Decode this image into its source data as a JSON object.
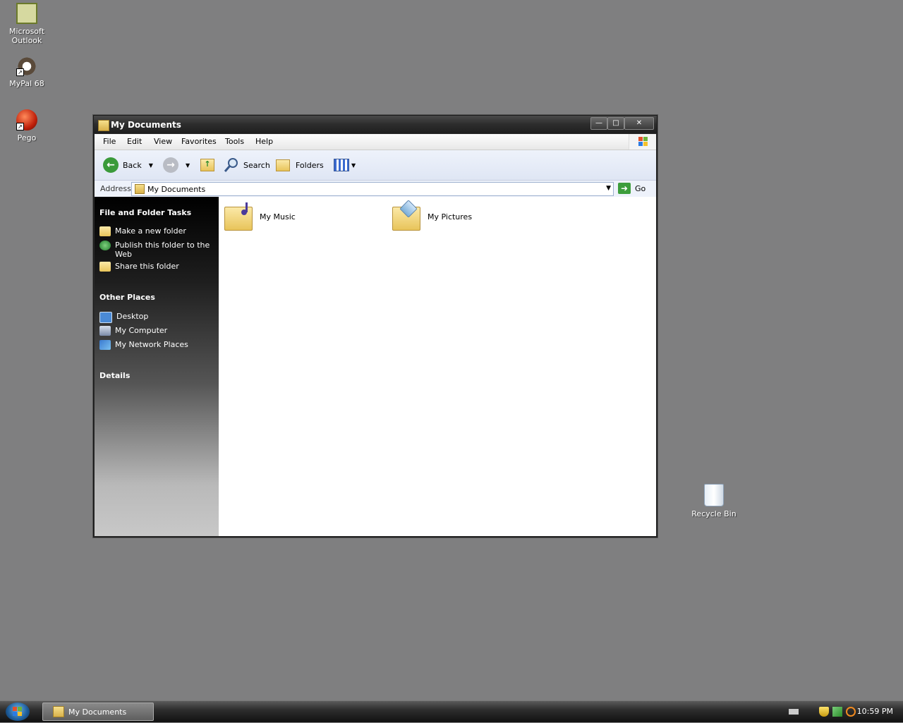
{
  "desktop": {
    "icons": [
      {
        "label_line1": "Microsoft",
        "label_line2": "Outlook",
        "icon": "outlook-icon"
      },
      {
        "label": "MyPal 68",
        "icon": "mypal-icon"
      },
      {
        "label": "Pego",
        "icon": "pego-icon"
      },
      {
        "label": "Recycle Bin",
        "icon": "recycle-bin-icon"
      }
    ]
  },
  "window": {
    "title": "My Documents",
    "menu": [
      "File",
      "Edit",
      "View",
      "Favorites",
      "Tools",
      "Help"
    ],
    "toolbar": {
      "back": "Back",
      "search": "Search",
      "folders": "Folders"
    },
    "address": {
      "label": "Address",
      "value": "My Documents",
      "go": "Go"
    },
    "taskpane": {
      "file_tasks_title": "File and Folder Tasks",
      "file_tasks": [
        {
          "label": "Make a new folder",
          "icon": "new-folder-icon"
        },
        {
          "label": "Publish this folder to the Web",
          "icon": "publish-web-icon"
        },
        {
          "label": "Share this folder",
          "icon": "share-folder-icon"
        }
      ],
      "other_places_title": "Other Places",
      "other_places": [
        {
          "label": "Desktop",
          "icon": "desktop-icon"
        },
        {
          "label": "My Computer",
          "icon": "computer-icon"
        },
        {
          "label": "My Network Places",
          "icon": "network-icon"
        }
      ],
      "details_title": "Details"
    },
    "items": [
      {
        "label": "My Music",
        "icon": "music-folder-icon"
      },
      {
        "label": "My Pictures",
        "icon": "pictures-folder-icon"
      }
    ]
  },
  "taskbar": {
    "task": "My Documents",
    "clock": "10:59 PM"
  }
}
